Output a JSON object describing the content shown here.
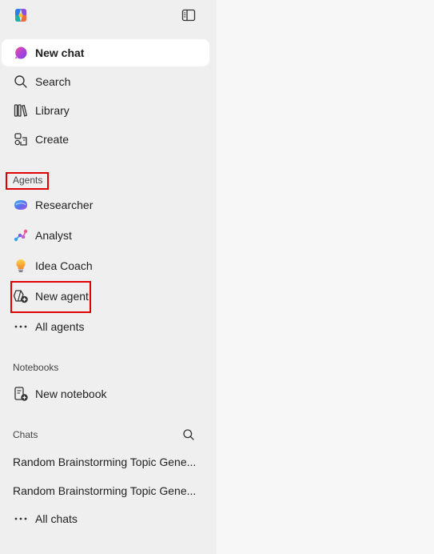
{
  "sidebar": {
    "logo_icon": "copilot-logo-icon",
    "collapse_icon": "sidebar-toggle-icon",
    "nav": {
      "new_chat": "New chat",
      "search": "Search",
      "library": "Library",
      "create": "Create"
    },
    "agents": {
      "heading": "Agents",
      "items": [
        {
          "label": "Researcher",
          "icon": "researcher-icon"
        },
        {
          "label": "Analyst",
          "icon": "analyst-icon"
        },
        {
          "label": "Idea Coach",
          "icon": "lightbulb-icon"
        },
        {
          "label": "New agent",
          "icon": "new-agent-icon"
        },
        {
          "label": "All agents",
          "icon": "more-icon"
        }
      ]
    },
    "notebooks": {
      "heading": "Notebooks",
      "new_notebook": "New notebook"
    },
    "chats": {
      "heading": "Chats",
      "items": [
        "Random Brainstorming Topic Gene...",
        "Random Brainstorming Topic Gene..."
      ],
      "all_chats": "All chats"
    },
    "highlight_color": "#e00000"
  }
}
